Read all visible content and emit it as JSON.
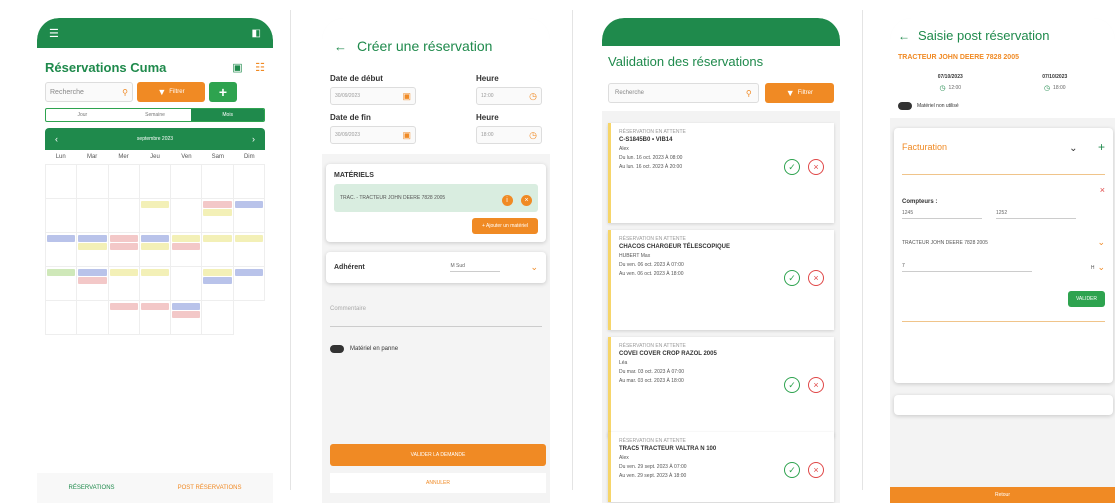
{
  "colors": {
    "green": "#1f8a4c",
    "orange": "#f08a24",
    "light_green": "#e7f3ea"
  },
  "phone1": {
    "title": "Réservations Cuma",
    "search_placeholder": "Recherche",
    "filter_label": "Filtrer",
    "add_label": "+",
    "view_tabs": [
      "Jour",
      "Semaine",
      "Mois"
    ],
    "active_view": "Mois",
    "month_label": "septembre 2023",
    "weekdays": [
      "Lun",
      "Mar",
      "Mer",
      "Jeu",
      "Ven",
      "Sam",
      "Dim"
    ],
    "bottom_tabs": [
      "RÉSERVATIONS",
      "POST RÉSERVATIONS"
    ]
  },
  "phone2": {
    "title": "Créer une réservation",
    "start_date_label": "Date de début",
    "start_date_value": "30/09/2023",
    "start_hour_label": "Heure",
    "start_hour_value": "12:00",
    "end_date_label": "Date de fin",
    "end_date_value": "30/09/2023",
    "end_hour_label": "Heure",
    "end_hour_value": "18:00",
    "materials_title": "MATÉRIELS",
    "material_item": "TRAC. - TRACTEUR JOHN DEERE 7828 2005",
    "add_material_label": "+ Ajouter un matériel",
    "member_label": "Adhérent",
    "member_value": "M Sud",
    "comment_placeholder": "Commentaire",
    "breakdown_label": "Matériel en panne",
    "validate_label": "VALIDER LA DEMANDE",
    "cancel_label": "ANNULER"
  },
  "phone3": {
    "title": "Validation des réservations",
    "search_placeholder": "Recherche",
    "filter_label": "Filtrer",
    "cards": [
      {
        "status": "RÉSERVATION EN ATTENTE",
        "material": "C-S1845B0 • VIB14",
        "person": "Alex",
        "from": "Du lun. 16 oct. 2023 À 08:00",
        "to": "Au lun. 16 oct. 2023 À 20:00"
      },
      {
        "status": "RÉSERVATION EN ATTENTE",
        "material": "CHACOS CHARGEUR TÉLESCOPIQUE",
        "person": "HUBERT Max",
        "from": "Du ven. 06 oct. 2023 À 07:00",
        "to": "Au ven. 06 oct. 2023 À 18:00"
      },
      {
        "status": "RÉSERVATION EN ATTENTE",
        "material": "COVEI COVER CROP RAZOL 2005",
        "person": "Léa",
        "from": "Du mar. 03 oct. 2023 À 07:00",
        "to": "Au mar. 03 oct. 2023 À 18:00"
      },
      {
        "status": "RÉSERVATION EN ATTENTE",
        "material": "TRAC5 TRACTEUR VALTRA N 100",
        "person": "Alex",
        "from": "Du ven. 29 sept. 2023 À 07:00",
        "to": "Au ven. 29 sept. 2023 À 18:00"
      }
    ]
  },
  "phone4": {
    "title": "Saisie post réservation",
    "material": "TRACTEUR JOHN DEERE 7828 2005",
    "start_date": "07/10/2023",
    "end_date": "07/10/2023",
    "start_time": "12:00",
    "end_time": "18:00",
    "unused_label": "Matériel non utilisé",
    "billing_title": "Facturation",
    "counters_label": "Compteurs :",
    "counter_start": "1245",
    "counter_end": "1252",
    "billing_material": "TRACTEUR JOHN DEERE 7828 2005",
    "quantity": "7",
    "unit": "H",
    "validate_label": "VALIDER",
    "bottom_label": "Retour"
  }
}
